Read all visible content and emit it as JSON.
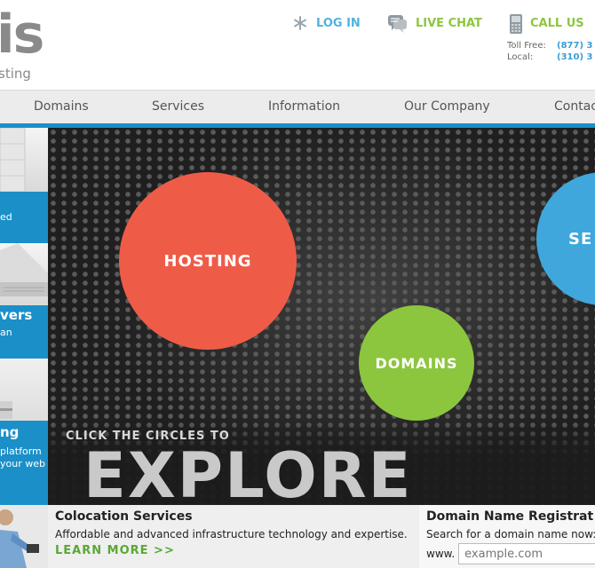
{
  "header": {
    "logo_big": "is",
    "logo_small": "sting",
    "login": "LOG IN",
    "live_chat": "LIVE CHAT",
    "call_us": "CALL US",
    "toll_free_label": "Toll Free:",
    "toll_free_number": "(877) 3",
    "local_label": "Local:",
    "local_number": "(310) 3"
  },
  "nav": {
    "items": [
      "Domains",
      "Services",
      "Information",
      "Our Company",
      "Contac"
    ]
  },
  "sidebar": {
    "items": [
      {
        "title": "",
        "sub": "ed"
      },
      {
        "title": "vers",
        "sub": "an"
      },
      {
        "title": "ng",
        "sub": "platform",
        "sub2": "your web"
      }
    ]
  },
  "hero": {
    "circle_hosting": "HOSTING",
    "circle_domains": "DOMAINS",
    "circle_services": "SE",
    "click_text": "CLICK THE CIRCLES TO",
    "explore_text": "EXPLORE"
  },
  "bottom": {
    "colo_title": "Colocation Services",
    "colo_desc": "Affordable and advanced infrastructure technology and expertise.",
    "colo_more": "LEARN MORE >>",
    "domain_title": "Domain Name Registrat",
    "domain_desc": "Search for a domain name now:",
    "domain_prefix": "www.",
    "domain_placeholder": "example.com"
  },
  "colors": {
    "accent_blue": "#1b8fc8",
    "accent_green": "#8cc63f",
    "hosting_red": "#ee5c48",
    "services_blue": "#3fa7dc"
  }
}
